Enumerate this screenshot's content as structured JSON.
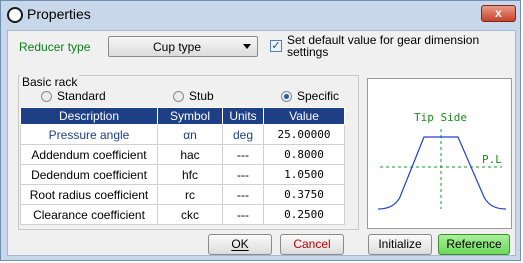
{
  "window": {
    "title": "Properties",
    "close_glyph": "x"
  },
  "reducer": {
    "label": "Reducer type",
    "selected": "Cup type"
  },
  "default_checkbox": {
    "checked": true,
    "label": "Set default value for gear dimension settings"
  },
  "basic_rack": {
    "label": "Basic rack",
    "options": [
      {
        "label": "Standard",
        "selected": false
      },
      {
        "label": "Stub",
        "selected": false
      },
      {
        "label": "Specific",
        "selected": true
      }
    ]
  },
  "table": {
    "headers": [
      "Description",
      "Symbol",
      "Units",
      "Value"
    ],
    "rows": [
      {
        "description": "Pressure angle",
        "symbol": "αn",
        "units": "deg",
        "value": "25.00000"
      },
      {
        "description": "Addendum coefficient",
        "symbol": "hac",
        "units": "---",
        "value": "0.8000"
      },
      {
        "description": "Dedendum coefficient",
        "symbol": "hfc",
        "units": "---",
        "value": "1.0500"
      },
      {
        "description": "Root radius coefficient",
        "symbol": "rc",
        "units": "---",
        "value": "0.3750"
      },
      {
        "description": "Clearance coefficient",
        "symbol": "ckc",
        "units": "---",
        "value": "0.2500"
      }
    ]
  },
  "diagram": {
    "tip_side_label": "Tip Side",
    "pitch_line_label": "P.L",
    "profile_color": "#2040d0",
    "axis_color": "#1a9a1a"
  },
  "buttons": {
    "ok": "OK",
    "cancel": "Cancel",
    "initialize": "Initialize",
    "reference": "Reference"
  }
}
